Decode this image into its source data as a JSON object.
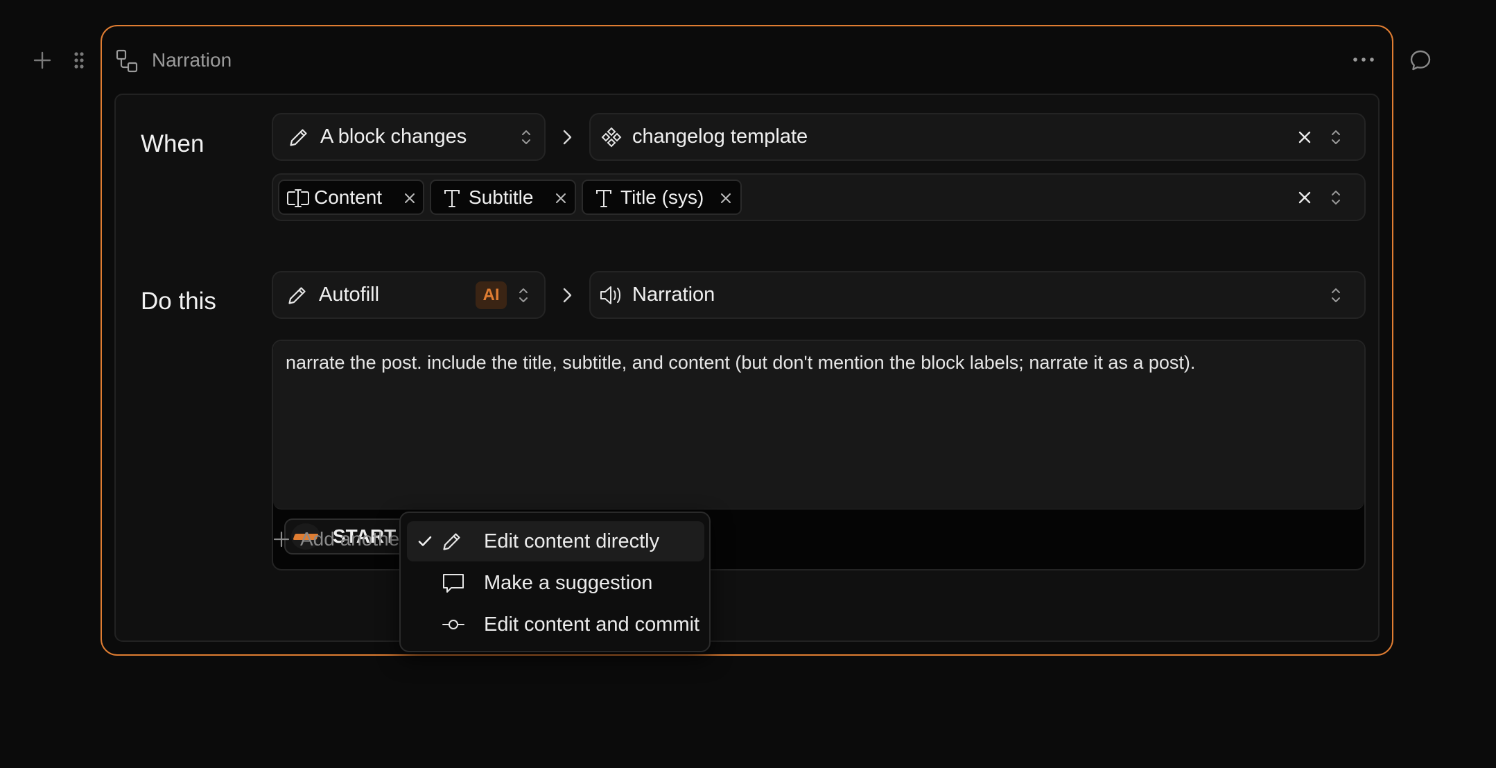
{
  "block": {
    "title": "Narration"
  },
  "when": {
    "label": "When",
    "trigger": "A block changes",
    "target": "changelog template",
    "fields": [
      "Content",
      "Subtitle",
      "Title (sys)"
    ]
  },
  "do_this": {
    "label": "Do this",
    "action": "Autofill",
    "ai_badge": "AI",
    "target": "Narration",
    "prompt": "narrate the post. include the title, subtitle, and content (but don't mention the block labels; narrate it as a post).",
    "start_label": "START"
  },
  "add_another": {
    "label": "Add another"
  },
  "mode_menu": {
    "items": [
      {
        "label": "Edit content directly",
        "icon": "pencil-icon",
        "selected": true
      },
      {
        "label": "Make a suggestion",
        "icon": "speech-bubble-icon",
        "selected": false
      },
      {
        "label": "Edit content and commit",
        "icon": "commit-icon",
        "selected": false
      }
    ]
  },
  "colors": {
    "accent": "#e07d32",
    "background": "#0b0b0b",
    "field": "#171717"
  }
}
